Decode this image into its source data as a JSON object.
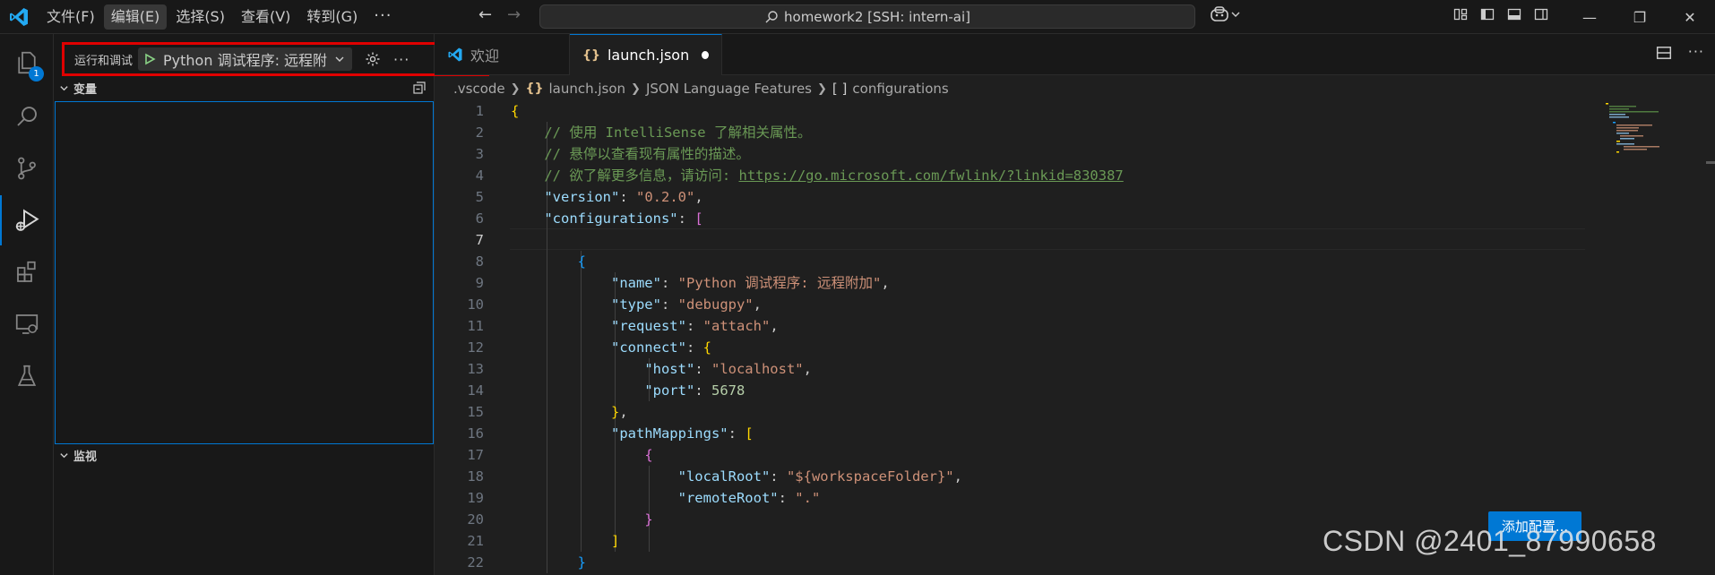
{
  "menu": {
    "items": [
      "文件(F)",
      "编辑(E)",
      "选择(S)",
      "查看(V)",
      "转到(G)"
    ],
    "more": "···"
  },
  "command_center": {
    "text": "homework2 [SSH: intern-ai]"
  },
  "activity_bar": {
    "badge": "1"
  },
  "debug_toolbar": {
    "label": "运行和调试",
    "config": "Python 调试程序: 远程附"
  },
  "sidebar": {
    "variables_title": "变量",
    "watch_title": "监视"
  },
  "tabs": [
    {
      "label": "欢迎",
      "icon": "vscode-logo-icon"
    },
    {
      "label": "launch.json",
      "icon": "json-icon",
      "dirty": true
    }
  ],
  "breadcrumb": [
    ".vscode",
    "launch.json",
    "JSON Language Features",
    "configurations"
  ],
  "editor": {
    "line_numbers": [
      "1",
      "2",
      "3",
      "4",
      "5",
      "6",
      "7",
      "8",
      "9",
      "10",
      "11",
      "12",
      "13",
      "14",
      "15",
      "16",
      "17",
      "18",
      "19",
      "20",
      "21",
      "22"
    ],
    "current_line": "7",
    "lines": [
      [
        {
          "t": "{",
          "c": "b1"
        }
      ],
      [
        {
          "t": "    // 使用 IntelliSense 了解相关属性。",
          "c": "t-com"
        }
      ],
      [
        {
          "t": "    // 悬停以查看现有属性的描述。",
          "c": "t-com"
        }
      ],
      [
        {
          "t": "    // 欲了解更多信息，请访问: ",
          "c": "t-com"
        },
        {
          "t": "https://go.microsoft.com/fwlink/?linkid=830387",
          "c": "t-link"
        }
      ],
      [
        {
          "t": "    ",
          "c": ""
        },
        {
          "t": "\"version\"",
          "c": "t-key"
        },
        {
          "t": ": ",
          "c": "t-punc"
        },
        {
          "t": "\"0.2.0\"",
          "c": "t-str"
        },
        {
          "t": ",",
          "c": "t-punc"
        }
      ],
      [
        {
          "t": "    ",
          "c": ""
        },
        {
          "t": "\"configurations\"",
          "c": "t-key"
        },
        {
          "t": ": ",
          "c": "t-punc"
        },
        {
          "t": "[",
          "c": "b2"
        }
      ],
      [
        {
          "t": "",
          "c": ""
        }
      ],
      [
        {
          "t": "        ",
          "c": ""
        },
        {
          "t": "{",
          "c": "b3"
        }
      ],
      [
        {
          "t": "            ",
          "c": ""
        },
        {
          "t": "\"name\"",
          "c": "t-key"
        },
        {
          "t": ": ",
          "c": "t-punc"
        },
        {
          "t": "\"Python 调试程序: 远程附加\"",
          "c": "t-str"
        },
        {
          "t": ",",
          "c": "t-punc"
        }
      ],
      [
        {
          "t": "            ",
          "c": ""
        },
        {
          "t": "\"type\"",
          "c": "t-key"
        },
        {
          "t": ": ",
          "c": "t-punc"
        },
        {
          "t": "\"debugpy\"",
          "c": "t-str"
        },
        {
          "t": ",",
          "c": "t-punc"
        }
      ],
      [
        {
          "t": "            ",
          "c": ""
        },
        {
          "t": "\"request\"",
          "c": "t-key"
        },
        {
          "t": ": ",
          "c": "t-punc"
        },
        {
          "t": "\"attach\"",
          "c": "t-str"
        },
        {
          "t": ",",
          "c": "t-punc"
        }
      ],
      [
        {
          "t": "            ",
          "c": ""
        },
        {
          "t": "\"connect\"",
          "c": "t-key"
        },
        {
          "t": ": ",
          "c": "t-punc"
        },
        {
          "t": "{",
          "c": "b1"
        }
      ],
      [
        {
          "t": "                ",
          "c": ""
        },
        {
          "t": "\"host\"",
          "c": "t-key"
        },
        {
          "t": ": ",
          "c": "t-punc"
        },
        {
          "t": "\"localhost\"",
          "c": "t-str"
        },
        {
          "t": ",",
          "c": "t-punc"
        }
      ],
      [
        {
          "t": "                ",
          "c": ""
        },
        {
          "t": "\"port\"",
          "c": "t-key"
        },
        {
          "t": ": ",
          "c": "t-punc"
        },
        {
          "t": "5678",
          "c": "t-num"
        }
      ],
      [
        {
          "t": "            ",
          "c": ""
        },
        {
          "t": "}",
          "c": "b1"
        },
        {
          "t": ",",
          "c": "t-punc"
        }
      ],
      [
        {
          "t": "            ",
          "c": ""
        },
        {
          "t": "\"pathMappings\"",
          "c": "t-key"
        },
        {
          "t": ": ",
          "c": "t-punc"
        },
        {
          "t": "[",
          "c": "b1"
        }
      ],
      [
        {
          "t": "                ",
          "c": ""
        },
        {
          "t": "{",
          "c": "b2"
        }
      ],
      [
        {
          "t": "                    ",
          "c": ""
        },
        {
          "t": "\"localRoot\"",
          "c": "t-key"
        },
        {
          "t": ": ",
          "c": "t-punc"
        },
        {
          "t": "\"${workspaceFolder}\"",
          "c": "t-str"
        },
        {
          "t": ",",
          "c": "t-punc"
        }
      ],
      [
        {
          "t": "                    ",
          "c": ""
        },
        {
          "t": "\"remoteRoot\"",
          "c": "t-key"
        },
        {
          "t": ": ",
          "c": "t-punc"
        },
        {
          "t": "\".\"",
          "c": "t-str"
        }
      ],
      [
        {
          "t": "                ",
          "c": ""
        },
        {
          "t": "}",
          "c": "b2"
        }
      ],
      [
        {
          "t": "            ",
          "c": ""
        },
        {
          "t": "]",
          "c": "b1"
        }
      ],
      [
        {
          "t": "        ",
          "c": ""
        },
        {
          "t": "}",
          "c": "b3"
        }
      ]
    ]
  },
  "add_config_button": "添加配置...",
  "watermark": "CSDN @2401_87990658",
  "colors": {
    "accent": "#0078d4",
    "highlight_border": "#e00000",
    "editor_bg": "#1f1f1f",
    "chrome_bg": "#181818"
  }
}
